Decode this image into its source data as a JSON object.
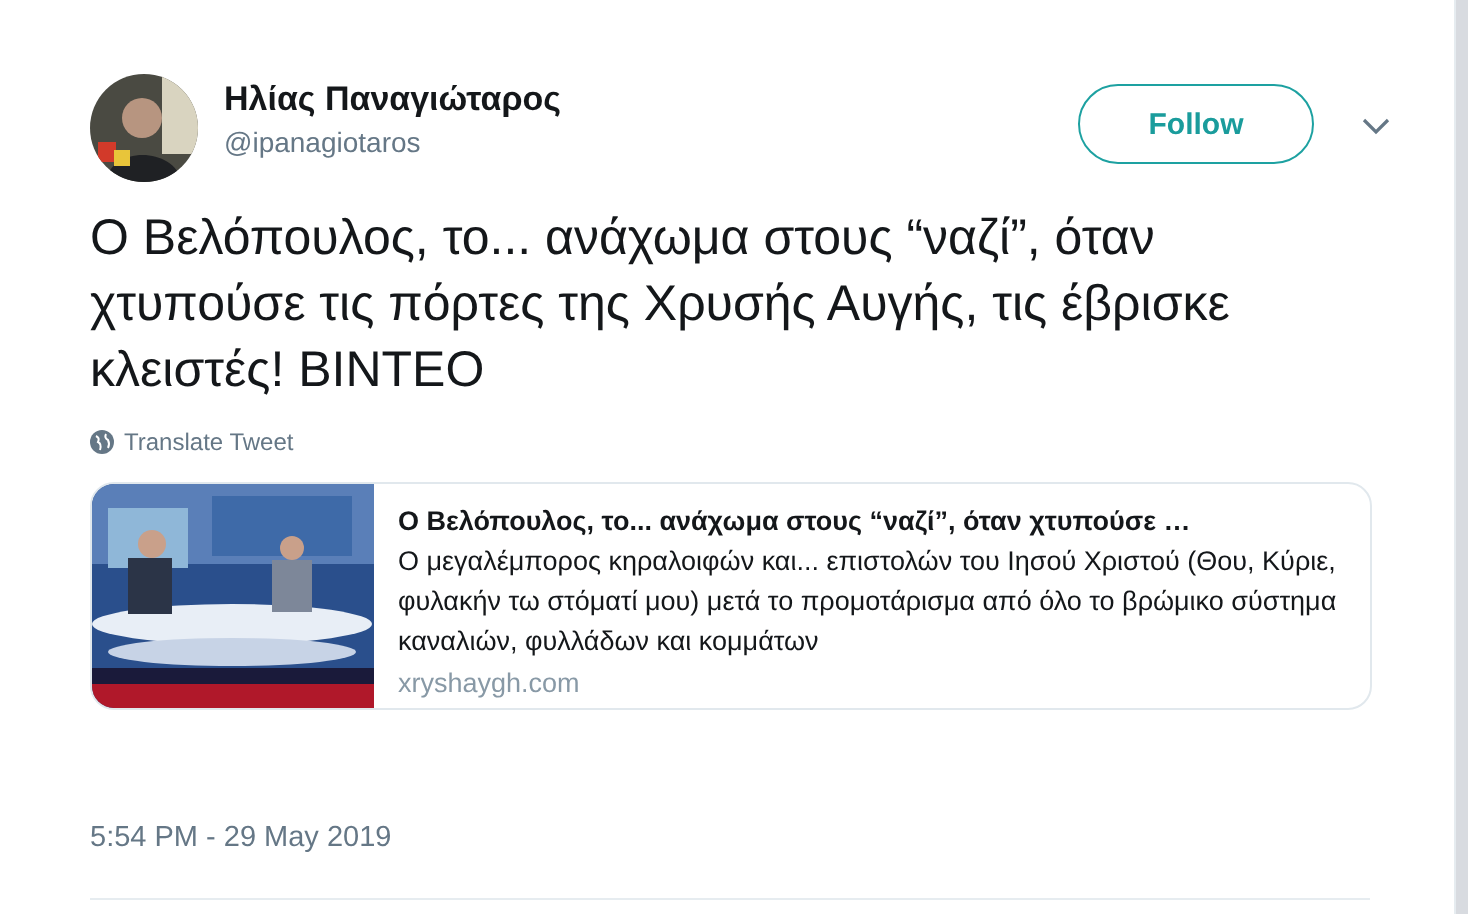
{
  "author": {
    "name": "Ηλίας Παναγιώταρος",
    "handle": "@ipanagiotaros"
  },
  "follow_button": "Follow",
  "tweet_text": "Ο Βελόπουλος, το... ανάχωμα στους “ναζί”, όταν χτυπούσε τις πόρτες της Χρυσής Αυγής, τις έβρισκε κλειστές! ΒΙΝΤΕΟ",
  "translate_link": "Translate Tweet",
  "link_card": {
    "title": "Ο Βελόπουλος, το... ανάχωμα στους “ναζί”, όταν χτυπούσε …",
    "description": "Ο μεγαλέμπορος κηραλοιφών και... επιστολών του Ιησού Χριστού (Θου, Κύριε, φυλακήν τω στόματί μου) μετά το προμοτάρισμα από όλο το βρώμικο σύστημα καναλιών, φυλλάδων και κομμάτων",
    "domain": "xryshaygh.com"
  },
  "timestamp": "5:54 PM - 29 May 2019"
}
